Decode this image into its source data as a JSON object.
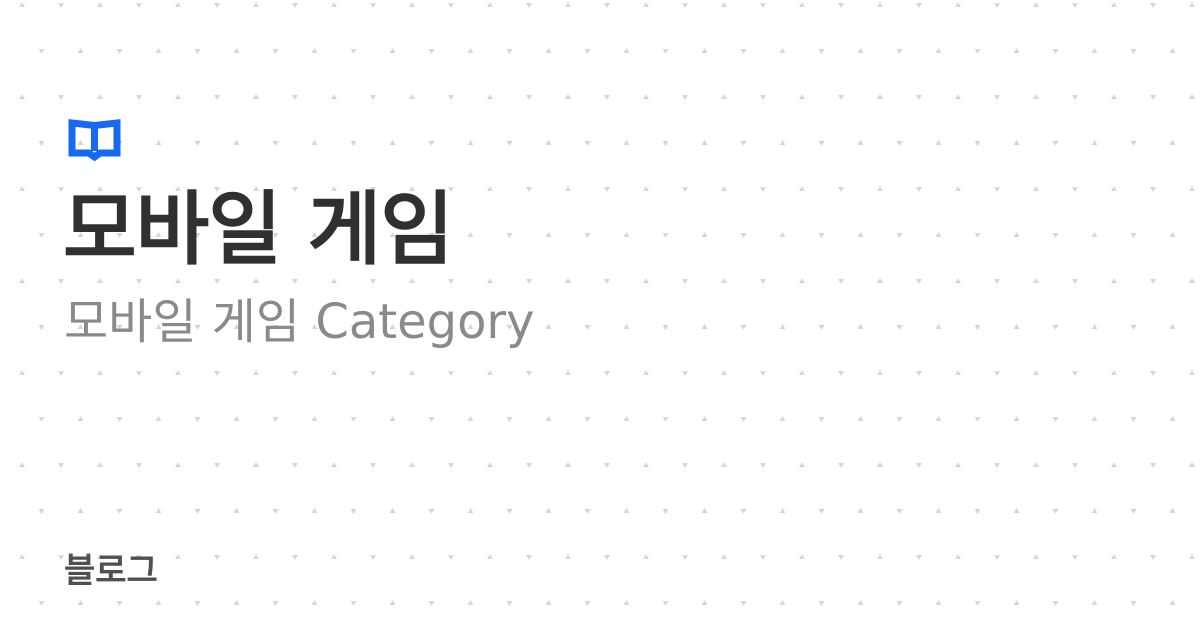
{
  "header": {
    "logo_icon": "open-book-icon",
    "title": "모바일 게임",
    "subtitle": "모바일 게임 Category"
  },
  "footer": {
    "label": "블로그"
  },
  "colors": {
    "accent": "#1769f2",
    "title_text": "#303030",
    "subtitle_text": "#8a8a8a",
    "footer_text": "#505050",
    "pattern_mark": "#d6d6d6",
    "background": "#ffffff"
  }
}
